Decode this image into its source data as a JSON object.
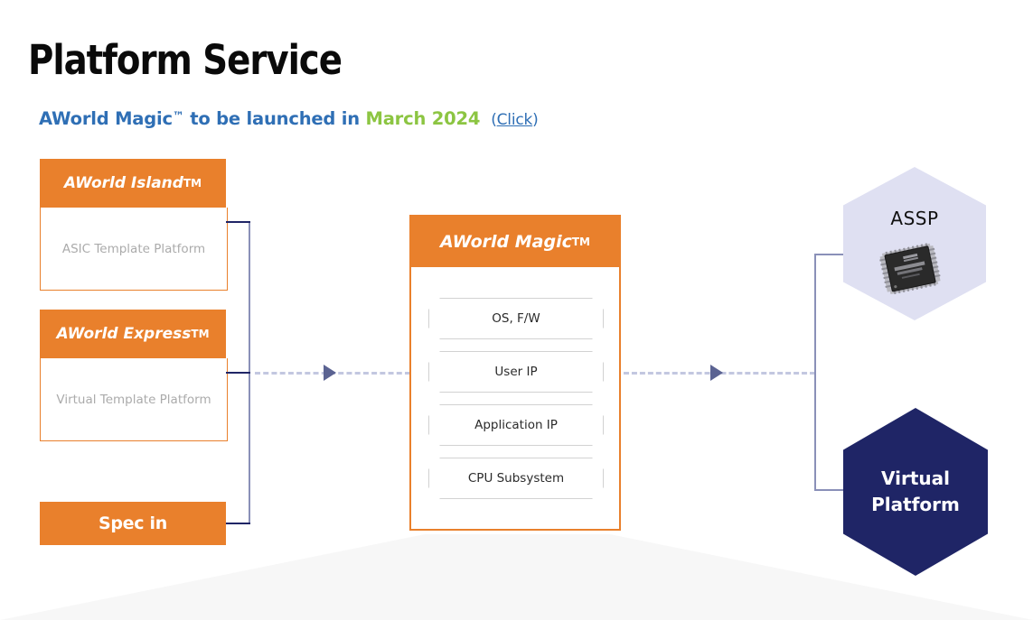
{
  "header": {
    "title": "Platform Service",
    "subtitle_lead": "AWorld Magic",
    "subtitle_tm": "™",
    "subtitle_mid": " to be launched in ",
    "subtitle_date": "March 2024",
    "link_open": "(",
    "link_text": "Click",
    "link_close": ")"
  },
  "left_column": {
    "blocks": [
      {
        "title": "AWorld Island ",
        "title_tm": "TM",
        "body": "ASIC Template Platform"
      },
      {
        "title": "AWorld Express",
        "title_tm": "TM",
        "body": "Virtual Template Platform"
      }
    ],
    "spec_in": "Spec in"
  },
  "center": {
    "title": "AWorld Magic",
    "title_tm": "TM",
    "layers": [
      "OS, F/W",
      "User IP",
      "Application IP",
      "CPU Subsystem"
    ]
  },
  "right_column": {
    "assp": {
      "label": "ASSP",
      "chip_icon": "integrated-circuit-chip-icon"
    },
    "virtual_platform": {
      "line1": "Virtual",
      "line2": "Platform"
    }
  },
  "colors": {
    "orange": "#e9802c",
    "navy": "#1f2566",
    "lavender": "#dfe0f2",
    "blue_text": "#2f6fb5",
    "green_text": "#8cc542",
    "gray_text": "#ababab",
    "connector": "#8a90b8",
    "dashed": "#c3c7e0",
    "arrow": "#5b6392"
  }
}
